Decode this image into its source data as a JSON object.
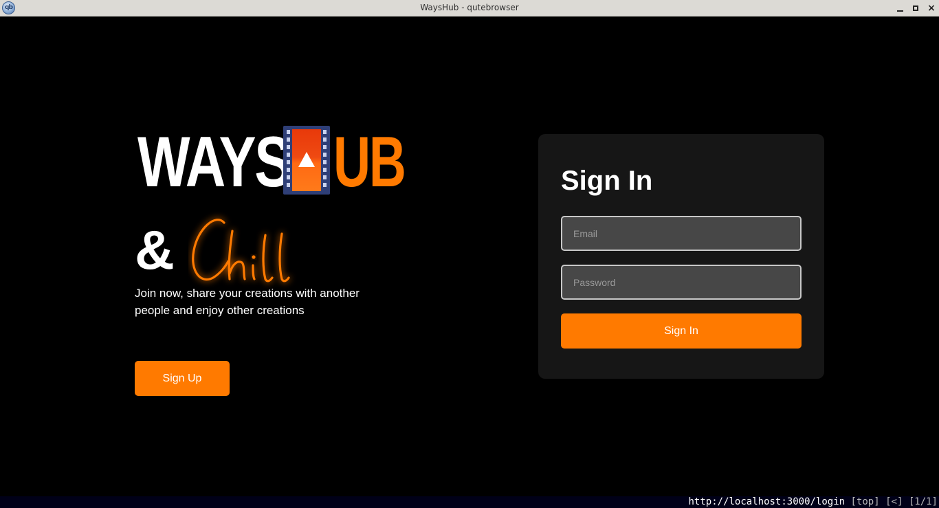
{
  "window": {
    "title": "WaysHub - qutebrowser",
    "app_icon_label": "qb",
    "controls": {
      "minimize": "minimize-icon",
      "maximize": "maximize-icon",
      "close": "×"
    }
  },
  "hero": {
    "logo": {
      "word1": "WAYS",
      "word2": "UB",
      "amp": "&",
      "script": "Chill",
      "icon": "film-strip-play-icon"
    },
    "tagline": "Join now, share your creations with another people and enjoy other creations",
    "signup_label": "Sign Up"
  },
  "signin": {
    "title": "Sign In",
    "email_placeholder": "Email",
    "email_value": "",
    "password_placeholder": "Password",
    "password_value": "",
    "button_label": "Sign In"
  },
  "statusbar": {
    "url": "http://localhost:3000/login",
    "scroll": "[top]",
    "history": "[<]",
    "tabs": "[1/1]"
  },
  "colors": {
    "accent": "#ff7a00",
    "background": "#000000",
    "card": "#161616",
    "input": "#474747",
    "film": "#2f3f77"
  }
}
